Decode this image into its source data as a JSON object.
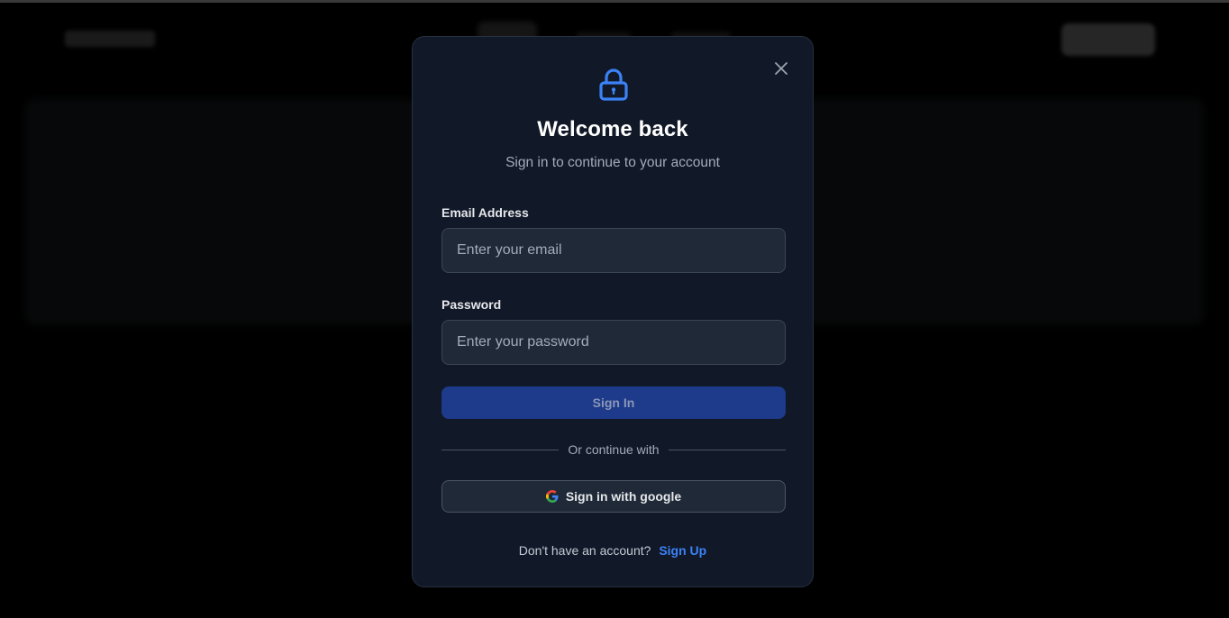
{
  "modal": {
    "title": "Welcome back",
    "subtitle": "Sign in to continue to your account",
    "email": {
      "label": "Email Address",
      "placeholder": "Enter your email",
      "value": ""
    },
    "password": {
      "label": "Password",
      "placeholder": "Enter your password",
      "value": ""
    },
    "signin_label": "Sign In",
    "divider_text": "Or continue with",
    "google_label": "Sign in with google",
    "footer_text": "Don't have an account?",
    "signup_label": "Sign Up",
    "icons": {
      "top": "lock-icon",
      "close": "close-icon",
      "google": "google-icon"
    }
  },
  "colors": {
    "accent": "#3b82f6",
    "primary_button": "#1e3a8a",
    "modal_background": "#111827"
  }
}
